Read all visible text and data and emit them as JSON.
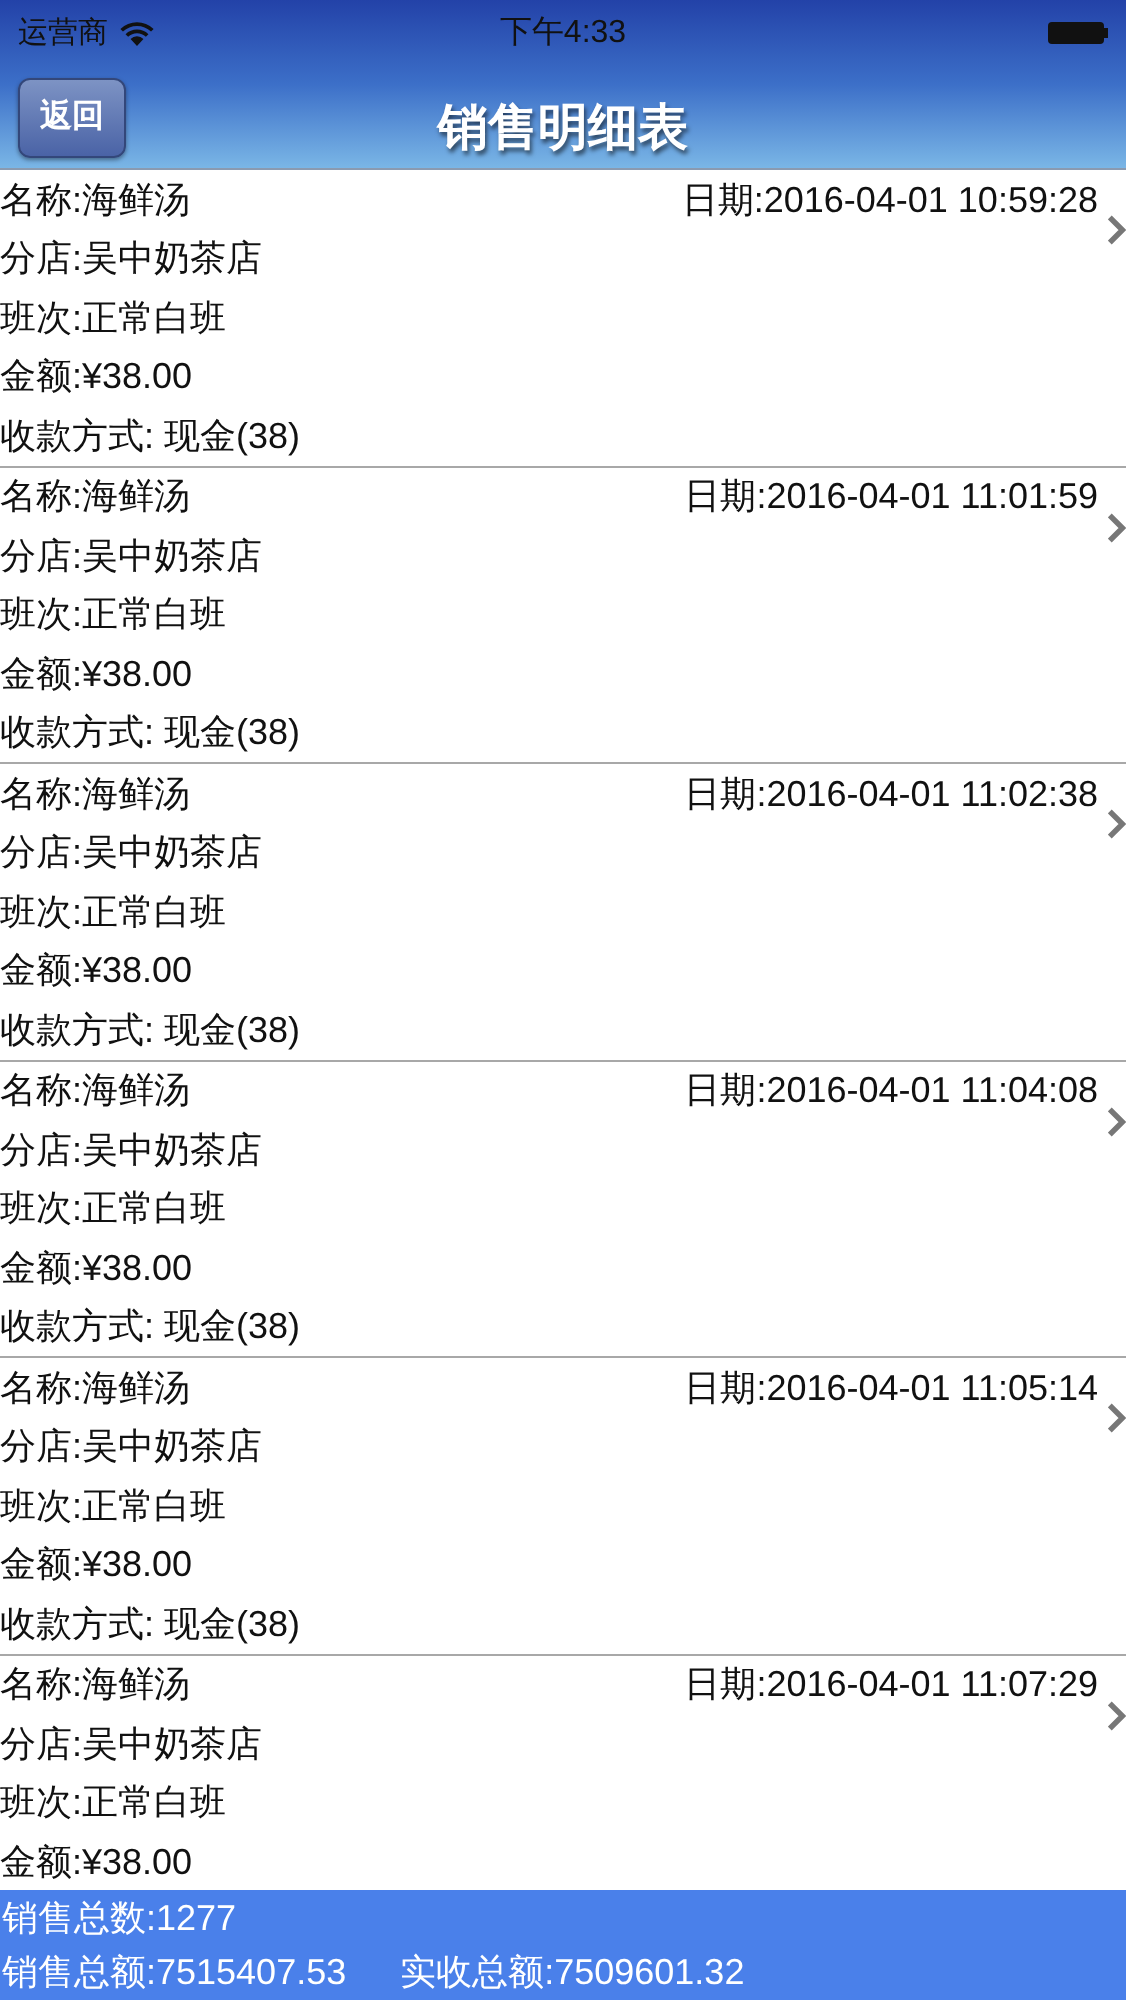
{
  "status_bar": {
    "carrier": "运营商",
    "time": "下午4:33"
  },
  "nav": {
    "back": "返回",
    "title": "销售明细表"
  },
  "records": [
    {
      "name": "名称:海鲜汤",
      "date": "日期:2016-04-01 10:59:28",
      "store": "分店:吴中奶茶店",
      "shift": "班次:正常白班",
      "amount": "金额:¥38.00",
      "payment": "收款方式: 现金(38)"
    },
    {
      "name": "名称:海鲜汤",
      "date": "日期:2016-04-01 11:01:59",
      "store": "分店:吴中奶茶店",
      "shift": "班次:正常白班",
      "amount": "金额:¥38.00",
      "payment": "收款方式: 现金(38)"
    },
    {
      "name": "名称:海鲜汤",
      "date": "日期:2016-04-01 11:02:38",
      "store": "分店:吴中奶茶店",
      "shift": "班次:正常白班",
      "amount": "金额:¥38.00",
      "payment": "收款方式: 现金(38)"
    },
    {
      "name": "名称:海鲜汤",
      "date": "日期:2016-04-01 11:04:08",
      "store": "分店:吴中奶茶店",
      "shift": "班次:正常白班",
      "amount": "金额:¥38.00",
      "payment": "收款方式: 现金(38)"
    },
    {
      "name": "名称:海鲜汤",
      "date": "日期:2016-04-01 11:05:14",
      "store": "分店:吴中奶茶店",
      "shift": "班次:正常白班",
      "amount": "金额:¥38.00",
      "payment": "收款方式: 现金(38)"
    },
    {
      "name": "名称:海鲜汤",
      "date": "日期:2016-04-01 11:07:29",
      "store": "分店:吴中奶茶店",
      "shift": "班次:正常白班",
      "amount": "金额:¥38.00"
    }
  ],
  "summary": {
    "count": "销售总数:1277",
    "total": "销售总额:7515407.53",
    "received": "实收总额:7509601.32"
  }
}
